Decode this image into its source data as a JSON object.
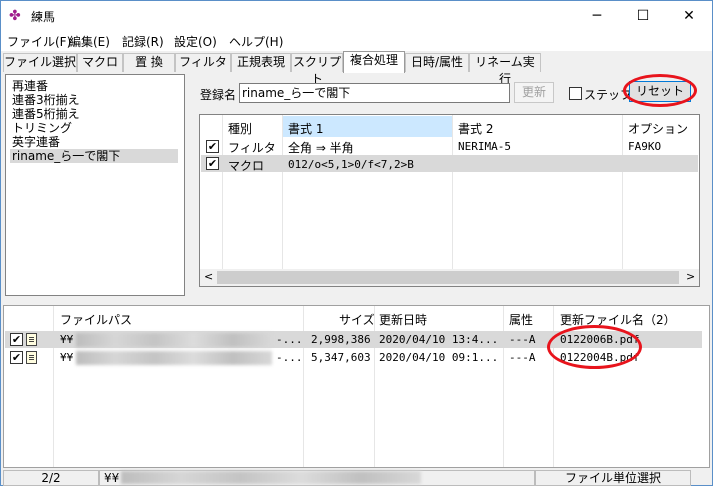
{
  "window": {
    "title": "練馬",
    "minimize": "─",
    "maximize": "☐",
    "close": "✕",
    "app_icon": "app-logo-icon"
  },
  "menu": [
    "ファイル(F)",
    "編集(E)",
    "記録(R)",
    "設定(O)",
    "ヘルプ(H)"
  ],
  "tabs": [
    "ファイル選択",
    "マクロ",
    "置 換",
    "フィルタ",
    "正規表現",
    "スクリプト",
    "複合処理",
    "日時/属性",
    "リネーム実行"
  ],
  "active_tab": "複合処理",
  "macro_list": [
    "再連番",
    "連番3桁揃え",
    "連番5桁揃え",
    "トリミング",
    "英字連番",
    "riname_ら一で閣下"
  ],
  "register": {
    "label": "登録名",
    "value": "riname_ら一で閣下",
    "update_button": "更新",
    "step_label": "ステップ",
    "reset_button": "リセット"
  },
  "rules_table": {
    "headers": [
      "種別",
      "書式 1",
      "書式 2",
      "オプション"
    ],
    "rows": [
      {
        "checked": "✔",
        "type": "フィルタ",
        "format1": "全角 ⇒ 半角",
        "format2": "NERIMA-5",
        "option": "FA9KO"
      },
      {
        "checked": "✔",
        "type": "マクロ",
        "format1": "012/o<5,1>0/f<7,2>B",
        "format2": "",
        "option": ""
      }
    ],
    "scroll_left": "<",
    "scroll_right": ">"
  },
  "files_table": {
    "headers": [
      "ファイルパス",
      "サイズ",
      "更新日時",
      "属性",
      "更新ファイル名（2）"
    ],
    "rows": [
      {
        "checked": "✔",
        "path": "¥¥",
        "path_tail": "-...",
        "size": "2,998,386",
        "date": "2020/04/10 13:4...",
        "attr": "---A",
        "newname": "0122006B.pdf"
      },
      {
        "checked": "✔",
        "path": "¥¥",
        "path_tail": "-...",
        "size": "5,347,603",
        "date": "2020/04/10 09:1...",
        "attr": "---A",
        "newname": "0122004B.pdf"
      }
    ]
  },
  "status": {
    "count": "2/2",
    "path": "¥¥",
    "mode": "ファイル単位選択"
  },
  "colors": {
    "highlight_circle": "#e8141c",
    "header_selected": "#cce8ff",
    "selected_row": "#d9d9d9"
  }
}
